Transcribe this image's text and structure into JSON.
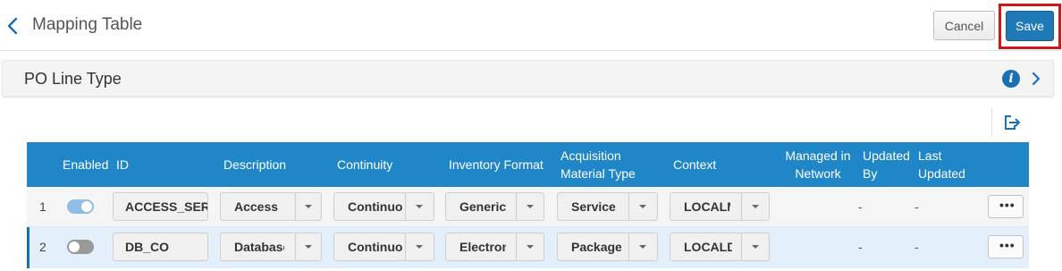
{
  "header": {
    "title": "Mapping Table",
    "cancel_label": "Cancel",
    "save_label": "Save"
  },
  "section": {
    "title": "PO Line Type"
  },
  "colors": {
    "accent": "#1f79b7",
    "table_header": "#1f86c8",
    "highlight_border": "#d0181c",
    "row_selected": "#e3effa"
  },
  "icons": {
    "back": "chevron-left-icon",
    "info": "info-icon",
    "expand": "chevron-right-icon",
    "export": "export-icon",
    "more": "ellipsis-icon"
  },
  "table": {
    "columns": [
      "Enabled",
      "ID",
      "Description",
      "Continuity",
      "Inventory Format",
      "Acquisition Material Type",
      "Context",
      "Managed in Network",
      "Updated By",
      "Last Updated"
    ],
    "rows": [
      {
        "num": "1",
        "enabled": true,
        "id": "ACCESS_SERVICE",
        "description": "Access Service",
        "continuity": "Continuous",
        "inventory_format": "Generic",
        "material_type": "Service",
        "context": "LOCALMATERIAL",
        "managed": "",
        "updated_by": "-",
        "last_updated": "-",
        "more": "•••"
      },
      {
        "num": "2",
        "enabled": false,
        "id": "DB_CO",
        "description": "Database",
        "continuity": "Continuous",
        "inventory_format": "Electronic",
        "material_type": "Package",
        "context": "LOCALDATA",
        "managed": "",
        "updated_by": "-",
        "last_updated": "-",
        "more": "•••"
      }
    ]
  }
}
